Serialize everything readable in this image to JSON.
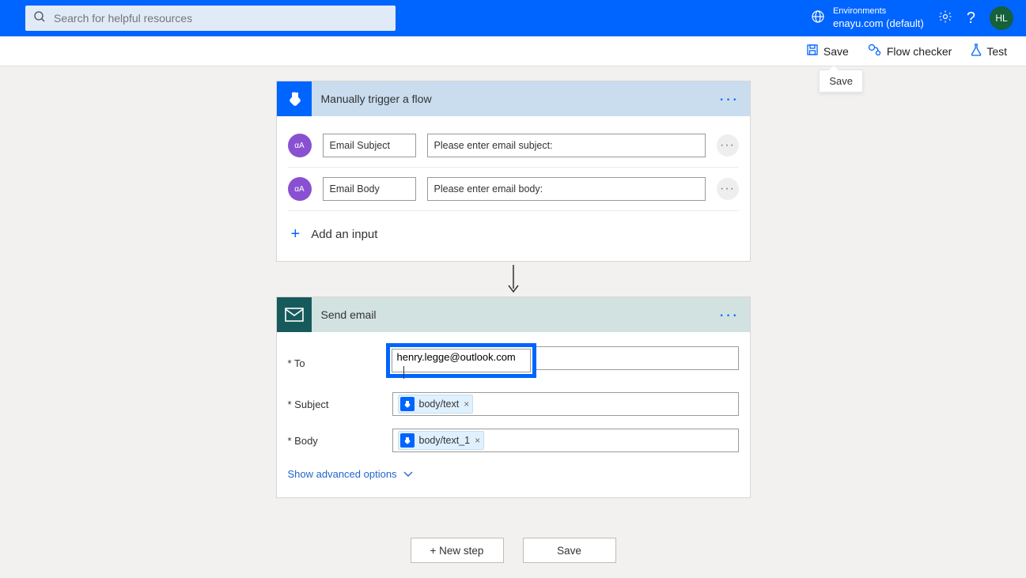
{
  "header": {
    "search_placeholder": "Search for helpful resources",
    "env_label": "Environments",
    "env_name": "enayu.com (default)",
    "avatar_initials": "HL"
  },
  "toolbar": {
    "save_label": "Save",
    "flow_checker_label": "Flow checker",
    "test_label": "Test",
    "tooltip_save": "Save"
  },
  "trigger": {
    "title": "Manually trigger a flow",
    "inputs": [
      {
        "name": "Email Subject",
        "value": "Please enter email subject:"
      },
      {
        "name": "Email Body",
        "value": "Please enter email body:"
      }
    ],
    "add_input_label": "Add an input"
  },
  "action": {
    "title": "Send email",
    "fields": {
      "to_label": "* To",
      "to_value": "henry.legge@outlook.com",
      "subject_label": "* Subject",
      "subject_token": "body/text",
      "body_label": "* Body",
      "body_token": "body/text_1"
    },
    "advanced_label": "Show advanced options"
  },
  "bottom": {
    "new_step_label": "+ New step",
    "save_label": "Save"
  }
}
